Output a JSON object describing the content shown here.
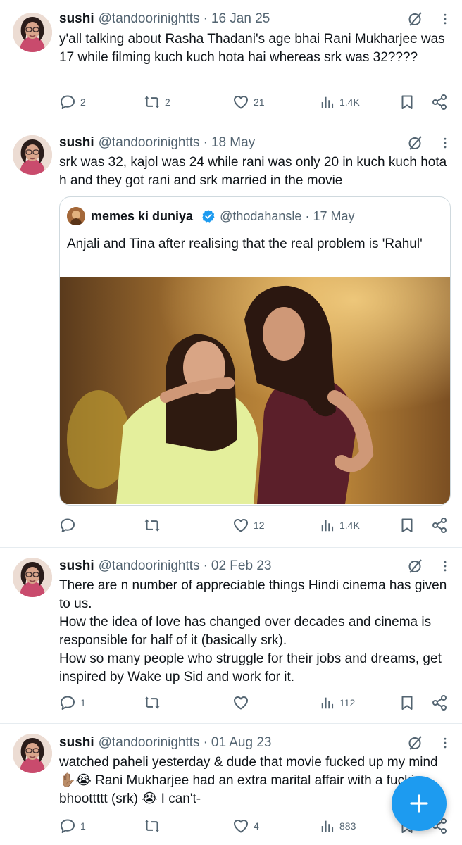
{
  "tweets": [
    {
      "author": "sushi",
      "handle": "@tandoorinightts",
      "date": "16 Jan 25",
      "text": "y'all talking about Rasha Thadani's age bhai Rani Mukharjee was 17 while filming kuch kuch hota hai whereas srk was 32????",
      "replies": "2",
      "reposts": "2",
      "likes": "21",
      "views": "1.4K"
    },
    {
      "author": "sushi",
      "handle": "@tandoorinightts",
      "date": "18 May",
      "text": "srk was 32, kajol was 24 while rani was only 20 in kuch kuch hota h and they got rani and srk married in the movie",
      "quote": {
        "author": "memes ki duniya",
        "handle": "@thodahansle",
        "date": "17 May",
        "text": "Anjali and Tina after realising that the real problem is 'Rahul'"
      },
      "replies": "",
      "reposts": "",
      "likes": "12",
      "views": "1.4K"
    },
    {
      "author": "sushi",
      "handle": "@tandoorinightts",
      "date": "02 Feb 23",
      "text_lines": [
        "There are n number of appreciable things Hindi cinema has given to us.",
        "How the idea of love has changed over decades and cinema is responsible for half of it (basically srk).",
        "How so many people who struggle for their jobs and dreams, get inspired by Wake up Sid and work for it."
      ],
      "replies": "1",
      "reposts": "",
      "likes": "",
      "views": "112"
    },
    {
      "author": "sushi",
      "handle": "@tandoorinightts",
      "date": "01 Aug 23",
      "text": "watched paheli yesterday & dude that movie fucked up my mind ✋🏽😭 Rani Mukharjee had an extra marital affair with a fucking bhoottttt (srk) 😭 I can't-",
      "replies": "1",
      "reposts": "",
      "likes": "4",
      "views": "883"
    }
  ],
  "colors": {
    "accent": "#1d9bf0",
    "muted": "#536471",
    "border": "#e6ecf0"
  },
  "icons": [
    "grok-icon",
    "more-icon",
    "reply-icon",
    "repost-icon",
    "like-icon",
    "views-icon",
    "bookmark-icon",
    "share-icon",
    "verified-badge-icon",
    "plus-icon"
  ]
}
